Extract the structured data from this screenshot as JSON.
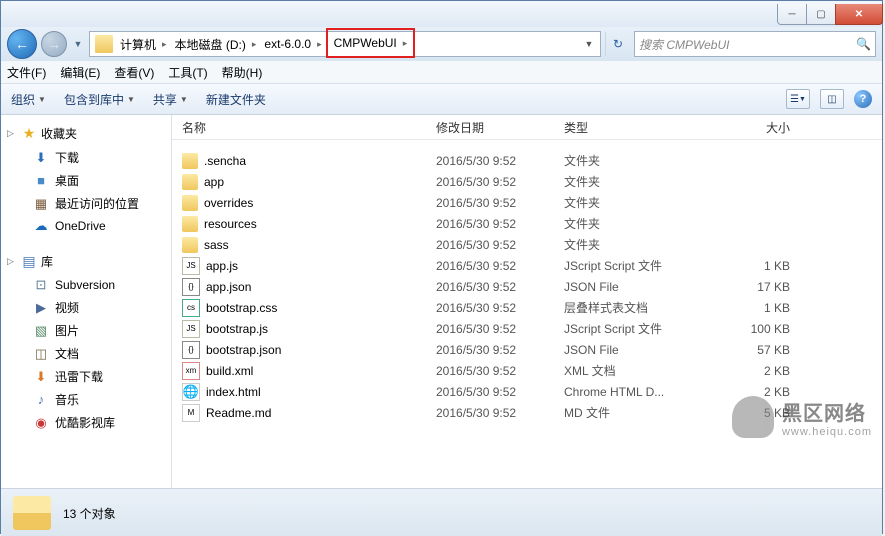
{
  "address": {
    "segments": [
      "计算机",
      "本地磁盘 (D:)",
      "ext-6.0.0",
      "CMPWebUI"
    ],
    "highlighted_index": 3
  },
  "search": {
    "placeholder": "搜索 CMPWebUI"
  },
  "menu": {
    "file": "文件(F)",
    "edit": "编辑(E)",
    "view": "查看(V)",
    "tools": "工具(T)",
    "help": "帮助(H)"
  },
  "toolbar": {
    "organize": "组织",
    "include": "包含到库中",
    "share": "共享",
    "newfolder": "新建文件夹"
  },
  "sidebar": {
    "fav_label": "收藏夹",
    "lib_label": "库",
    "favs": [
      {
        "icon": "⬇",
        "label": "下载",
        "color": "#2a6db8"
      },
      {
        "icon": "■",
        "label": "桌面",
        "color": "#4a8ac8"
      },
      {
        "icon": "▦",
        "label": "最近访问的位置",
        "color": "#7a5a3a"
      },
      {
        "icon": "☁",
        "label": "OneDrive",
        "color": "#1a6ab8"
      }
    ],
    "libs": [
      {
        "icon": "⊡",
        "label": "Subversion",
        "color": "#5a7a9a"
      },
      {
        "icon": "▶",
        "label": "视频",
        "color": "#4a6a9a"
      },
      {
        "icon": "▧",
        "label": "图片",
        "color": "#5a8a6a"
      },
      {
        "icon": "◫",
        "label": "文档",
        "color": "#7a6a4a"
      },
      {
        "icon": "⬇",
        "label": "迅雷下载",
        "color": "#d87a2a"
      },
      {
        "icon": "♪",
        "label": "音乐",
        "color": "#4a7aba"
      },
      {
        "icon": "◉",
        "label": "优酷影视库",
        "color": "#c83a3a"
      }
    ]
  },
  "columns": {
    "name": "名称",
    "date": "修改日期",
    "type": "类型",
    "size": "大小"
  },
  "files": [
    {
      "icon": "folder",
      "name": ".sencha",
      "date": "2016/5/30 9:52",
      "type": "文件夹",
      "size": ""
    },
    {
      "icon": "folder",
      "name": "app",
      "date": "2016/5/30 9:52",
      "type": "文件夹",
      "size": ""
    },
    {
      "icon": "folder",
      "name": "overrides",
      "date": "2016/5/30 9:52",
      "type": "文件夹",
      "size": ""
    },
    {
      "icon": "folder",
      "name": "resources",
      "date": "2016/5/30 9:52",
      "type": "文件夹",
      "size": ""
    },
    {
      "icon": "folder",
      "name": "sass",
      "date": "2016/5/30 9:52",
      "type": "文件夹",
      "size": ""
    },
    {
      "icon": "js",
      "name": "app.js",
      "date": "2016/5/30 9:52",
      "type": "JScript Script 文件",
      "size": "1 KB"
    },
    {
      "icon": "json",
      "name": "app.json",
      "date": "2016/5/30 9:52",
      "type": "JSON File",
      "size": "17 KB"
    },
    {
      "icon": "css",
      "name": "bootstrap.css",
      "date": "2016/5/30 9:52",
      "type": "层叠样式表文档",
      "size": "1 KB"
    },
    {
      "icon": "js",
      "name": "bootstrap.js",
      "date": "2016/5/30 9:52",
      "type": "JScript Script 文件",
      "size": "100 KB"
    },
    {
      "icon": "json",
      "name": "bootstrap.json",
      "date": "2016/5/30 9:52",
      "type": "JSON File",
      "size": "57 KB"
    },
    {
      "icon": "xml",
      "name": "build.xml",
      "date": "2016/5/30 9:52",
      "type": "XML 文档",
      "size": "2 KB"
    },
    {
      "icon": "html",
      "name": "index.html",
      "date": "2016/5/30 9:52",
      "type": "Chrome HTML D...",
      "size": "2 KB"
    },
    {
      "icon": "md",
      "name": "Readme.md",
      "date": "2016/5/30 9:52",
      "type": "MD 文件",
      "size": "5 KB"
    }
  ],
  "status": {
    "count": "13 个对象"
  },
  "watermark": {
    "title": "黑区网络",
    "url": "www.heiqu.com"
  }
}
